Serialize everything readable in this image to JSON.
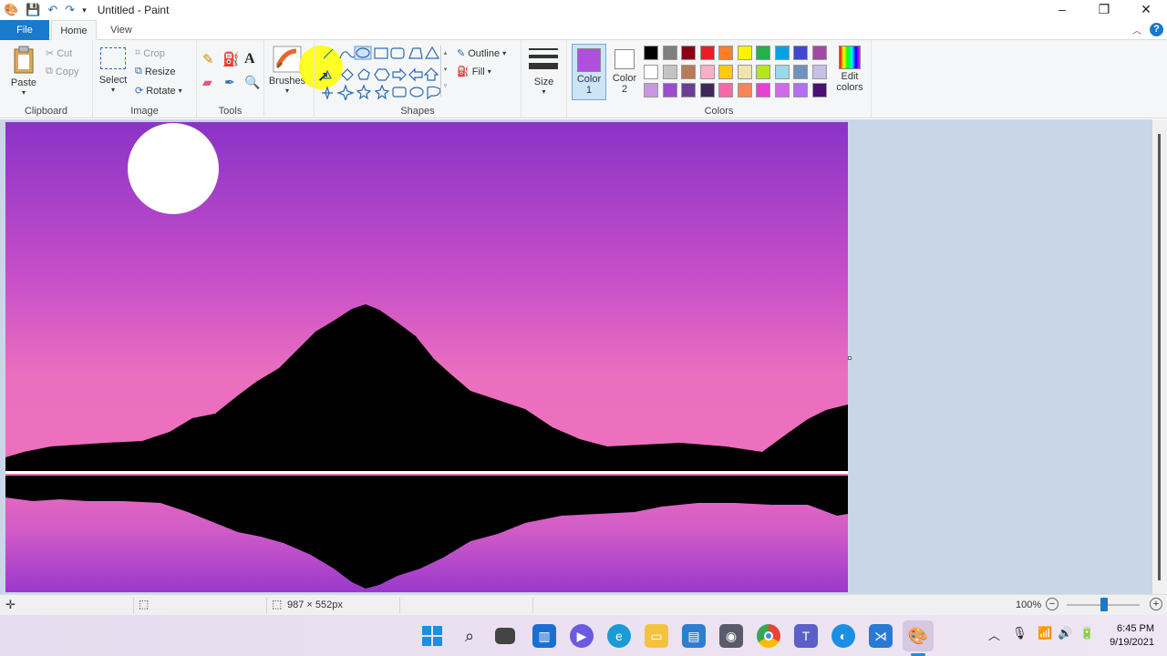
{
  "window": {
    "title": "Untitled - Paint",
    "minimize": "–",
    "maximize": "❐",
    "close": "✕"
  },
  "tabs": {
    "file": "File",
    "home": "Home",
    "view": "View"
  },
  "help": "?",
  "ribbon": {
    "clipboard": {
      "label": "Clipboard",
      "paste": "Paste",
      "cut": "Cut",
      "copy": "Copy"
    },
    "image": {
      "label": "Image",
      "select": "Select",
      "crop": "Crop",
      "resize": "Resize",
      "rotate": "Rotate"
    },
    "tools": {
      "label": "Tools"
    },
    "brushes": {
      "label": "Brushes"
    },
    "shapes": {
      "label": "Shapes",
      "outline": "Outline",
      "fill": "Fill"
    },
    "size": {
      "label": "Size"
    },
    "colors": {
      "label": "Colors",
      "color1": "Color\n1",
      "color2": "Color\n2",
      "edit": "Edit\ncolors",
      "color1_value": "#b04fdc",
      "color2_value": "#ffffff",
      "palette": [
        [
          "#000000",
          "#7f7f7f",
          "#880015",
          "#ed1c24",
          "#ff7f27",
          "#fff200",
          "#22b14c",
          "#00a2e8",
          "#3f48cc",
          "#a349a4"
        ],
        [
          "#ffffff",
          "#c3c3c3",
          "#b97a57",
          "#ffaec9",
          "#ffc90e",
          "#efe4b0",
          "#b5e61d",
          "#99d9ea",
          "#7092be",
          "#c8bfe7"
        ],
        [
          "#c897e0",
          "#9b4dca",
          "#6a3d9a",
          "#3d2a5a",
          "#f26aa6",
          "#f7845a",
          "#e83fd4",
          "#d06ae8",
          "#b46ef0",
          "#4a1075"
        ]
      ]
    }
  },
  "status": {
    "dimensions": "987 × 552px",
    "zoom": "100%"
  },
  "taskbar": {
    "time": "6:45 PM",
    "date": "9/19/2021"
  }
}
